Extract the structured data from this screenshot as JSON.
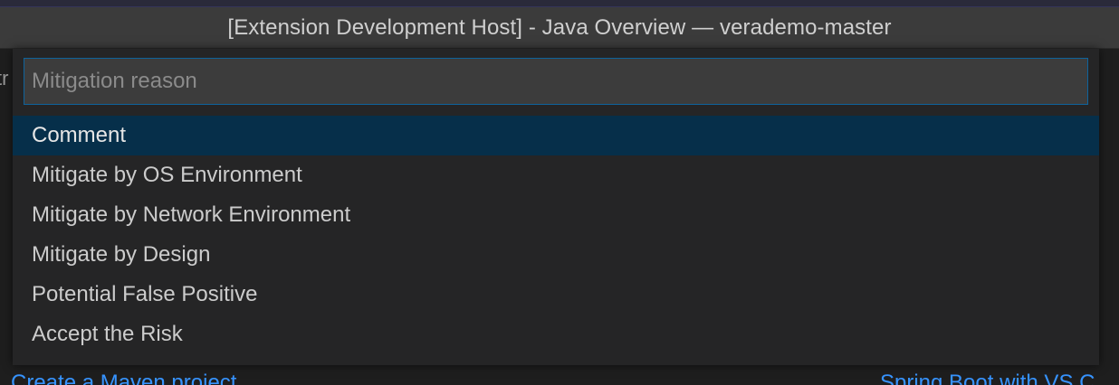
{
  "window": {
    "title": "[Extension Development Host] - Java Overview — verademo-master"
  },
  "background": {
    "left_fragment": "tr",
    "link_left": "Create a Maven project",
    "link_right": "Spring Boot with VS C"
  },
  "quick_pick": {
    "input_placeholder": "Mitigation reason",
    "input_value": "",
    "items": [
      {
        "label": "Comment",
        "active": true
      },
      {
        "label": "Mitigate by OS Environment",
        "active": false
      },
      {
        "label": "Mitigate by Network Environment",
        "active": false
      },
      {
        "label": "Mitigate by Design",
        "active": false
      },
      {
        "label": "Potential False Positive",
        "active": false
      },
      {
        "label": "Accept the Risk",
        "active": false
      }
    ]
  },
  "colors": {
    "selection_background": "#062f4a",
    "focus_border": "#0e639c",
    "link": "#3794ff"
  }
}
